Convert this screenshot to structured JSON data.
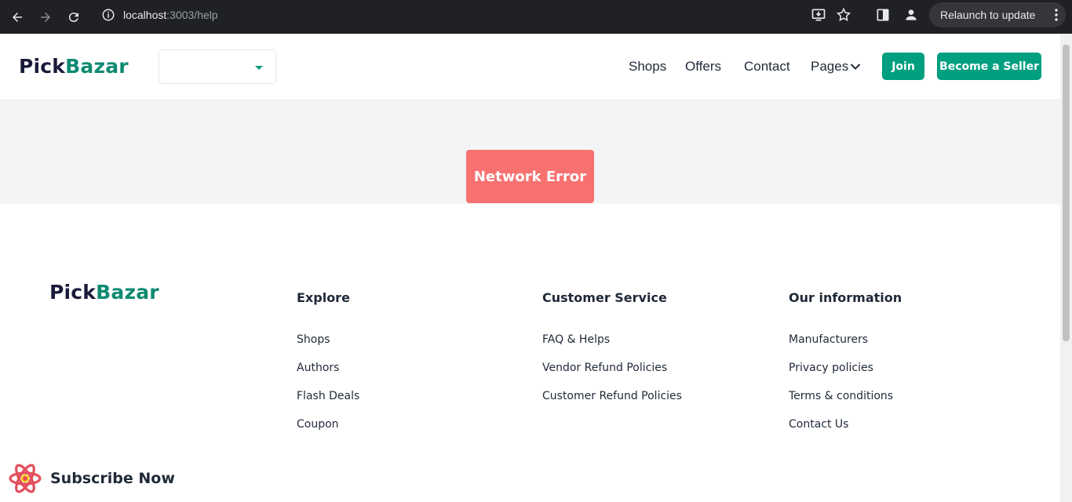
{
  "browser": {
    "url_host": "localhost",
    "url_path": ":3003/help",
    "relaunch_label": "Relaunch to update"
  },
  "header": {
    "logo_part1": "Pick",
    "logo_part2": "Bazar",
    "group_select_value": "",
    "nav": {
      "shops": "Shops",
      "offers": "Offers",
      "contact": "Contact",
      "pages": "Pages"
    },
    "join_label": "Join",
    "seller_label": "Become a Seller"
  },
  "main": {
    "error_message": "Network Error"
  },
  "footer": {
    "logo_part1": "Pick",
    "logo_part2": "Bazar",
    "explore": {
      "title": "Explore",
      "links": [
        "Shops",
        "Authors",
        "Flash Deals",
        "Coupon"
      ]
    },
    "customer_service": {
      "title": "Customer Service",
      "links": [
        "FAQ & Helps",
        "Vendor Refund Policies",
        "Customer Refund Policies"
      ]
    },
    "our_information": {
      "title": "Our information",
      "links": [
        "Manufacturers",
        "Privacy policies",
        "Terms & conditions",
        "Contact Us"
      ]
    },
    "subscribe_title": "Subscribe Now"
  },
  "colors": {
    "brand": "#009f7f",
    "logo_dark": "#1a1a3b",
    "error": "#f87171"
  }
}
